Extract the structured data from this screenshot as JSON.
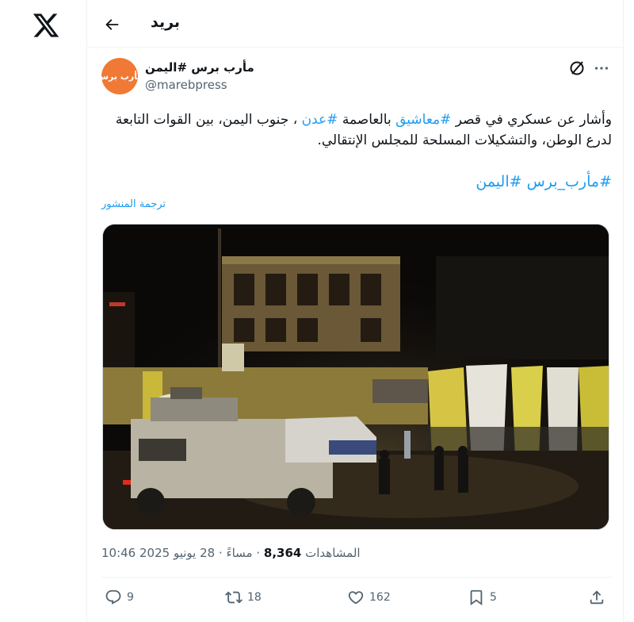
{
  "header": {
    "title": "بريد"
  },
  "tweet": {
    "author_name": "مأرب برس #اليمن",
    "handle": "@marebpress",
    "avatar_text": "مأرب برس",
    "text": {
      "p1": "وأشار عن عسكري في قصر ",
      "tag1": "#معاشيق",
      "p2": " بالعاصمة ",
      "tag2": "#عدن",
      "p3": " ، جنوب اليمن، بين القوات التابعة لدرع الوطن، والتشكيلات المسلحة للمجلس الإنتقالي."
    },
    "hashtags": [
      "#مأرب_برس",
      "#اليمن"
    ],
    "translate_label": "ترجمة المنشور",
    "time": "10:46",
    "date": "28 يونيو 2025",
    "period": "مساءً",
    "views_count": "8,364",
    "views_label": "المشاهدات"
  },
  "actions": {
    "replies": "9",
    "reposts": "18",
    "likes": "162",
    "bookmarks": "5"
  },
  "colors": {
    "accent": "#1d9bf0",
    "secondary_text": "#536471",
    "avatar_bg": "#f07a35"
  },
  "icons": [
    "x-logo-icon",
    "back-arrow-icon",
    "grok-icon",
    "more-icon",
    "reply-icon",
    "repost-icon",
    "like-icon",
    "bookmark-icon",
    "share-icon"
  ]
}
